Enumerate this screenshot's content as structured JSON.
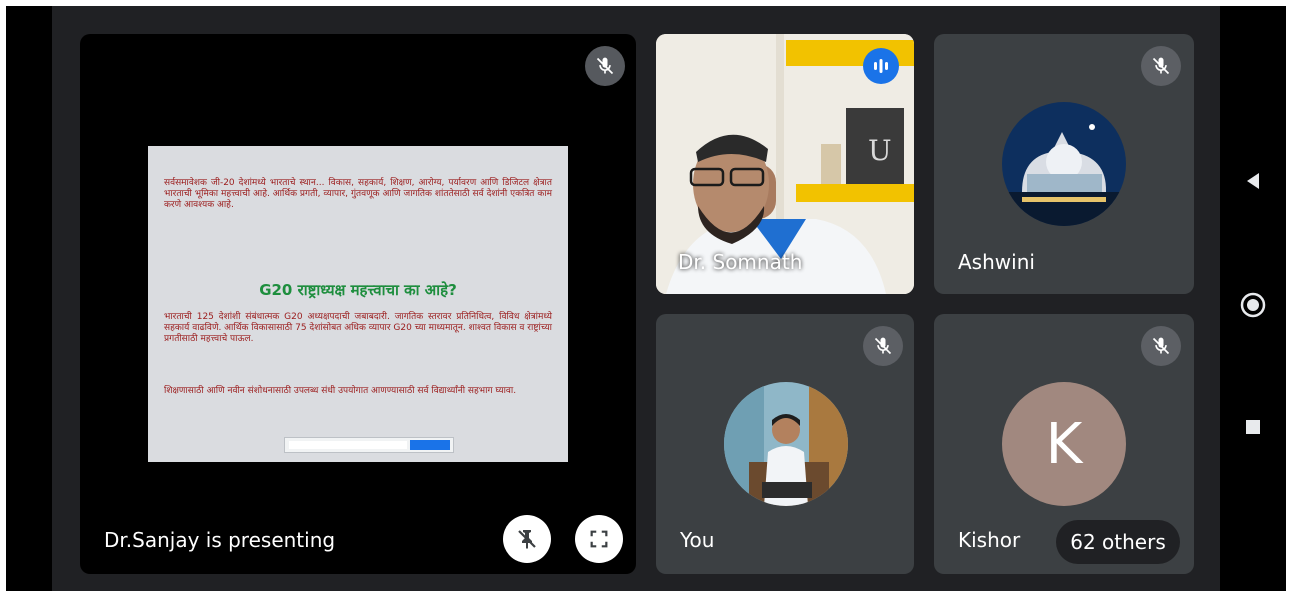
{
  "presenter": {
    "label": "Dr.Sanjay is presenting",
    "slide": {
      "paragraph_1": "सर्वसमावेशक जी-20 देशांमध्ये भारताचे स्थान... विकास, सहकार्य, शिक्षण, आरोग्य, पर्यावरण आणि डिजिटल क्षेत्रात भारताची भूमिका महत्त्वाची आहे. आर्थिक प्रगती, व्यापार, गुंतवणूक आणि जागतिक शांततेसाठी सर्व देशांनी एकत्रित काम करणे आवश्यक आहे.",
      "heading": "G20 राष्ट्राध्यक्ष महत्त्वाचा का आहे?",
      "paragraph_2": "भारताची 125 देशांशी संबंधात्मक G20 अध्यक्षपदाची जबाबदारी. जागतिक स्तरावर प्रतिनिधित्व, विविध क्षेत्रांमध्ये सहकार्य वाढविणे. आर्थिक विकासासाठी 75 देशांसोबत अधिक व्यापार G20 च्या माध्यमातून. शाश्वत विकास व राष्ट्रांच्या प्रगतीसाठी महत्त्वाचे पाऊल.",
      "paragraph_3": "शिक्षणासाठी आणि नवीन संशोधनासाठी उपलब्ध संधी उपयोगात आणण्यासाठी सर्व विद्यार्थ्यांनी सहभाग घ्यावा."
    }
  },
  "participants": {
    "somnath": {
      "name": "Dr. Somnath"
    },
    "ashwini": {
      "name": "Ashwini"
    },
    "you": {
      "name": "You"
    },
    "kishor": {
      "name": "Kishor",
      "initial": "K"
    }
  },
  "others": {
    "label": "62 others"
  },
  "colors": {
    "stage_bg": "#202124",
    "tile_bg": "#3c4043",
    "speaking_indicator": "#1a73e8",
    "avatar_k": "#a1887f"
  },
  "icons": {
    "mute": "mic-off-icon",
    "speaking": "audio-level-icon",
    "pin": "unpin-icon",
    "fullscreen": "fullscreen-icon",
    "nav_back": "triangle-back-icon",
    "nav_home": "circle-home-icon",
    "nav_recents": "square-recents-icon"
  }
}
